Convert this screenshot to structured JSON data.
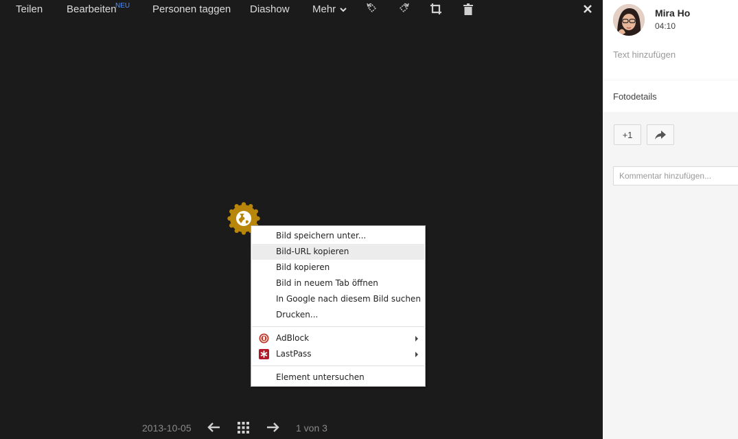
{
  "toolbar": {
    "share": "Teilen",
    "edit": "Bearbeiten",
    "edit_badge": "NEU",
    "tag_people": "Personen taggen",
    "slideshow": "Diashow",
    "more": "Mehr"
  },
  "context_menu": {
    "items": [
      "Bild speichern unter...",
      "Bild-URL kopieren",
      "Bild kopieren",
      "Bild in neuem Tab öffnen",
      "In Google nach diesem Bild suchen",
      "Drucken..."
    ],
    "highlighted_index": 1,
    "extensions": [
      "AdBlock",
      "LastPass"
    ],
    "inspect": "Element untersuchen"
  },
  "bottom": {
    "date": "2013-10-05",
    "counter": "1 von 3"
  },
  "sidebar": {
    "user_name": "Mira Ho",
    "time": "04:10",
    "add_text": "Text hinzufügen",
    "photo_details": "Fotodetails",
    "plus_one": "+1",
    "comment_placeholder": "Kommentar hinzufügen..."
  },
  "colors": {
    "viewer_bg": "#1c1b1b",
    "badge_gold": "#b8860b",
    "accent_new": "#4d90fe",
    "adblock_red": "#c0392b",
    "lastpass_red": "#b3182a"
  },
  "icons": [
    "rotate-left-icon",
    "rotate-right-icon",
    "crop-icon",
    "trash-icon",
    "close-icon",
    "globe-badge-icon",
    "adblock-icon",
    "lastpass-icon",
    "arrow-left-icon",
    "grid-icon",
    "arrow-right-icon",
    "share-arrow-icon"
  ]
}
